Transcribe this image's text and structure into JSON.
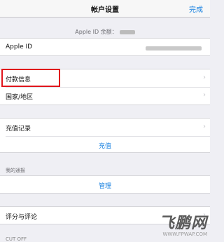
{
  "navbar": {
    "title": "帐户设置",
    "done": "完成"
  },
  "balance_label": "Apple ID 余额：",
  "apple_id": {
    "label": "Apple ID"
  },
  "payment": {
    "label": "付款信息"
  },
  "region": {
    "label": "国家/地区"
  },
  "recharge": {
    "label": "充值记录",
    "action": "充值"
  },
  "subscriptions": {
    "header": "我的通报",
    "action": "管理"
  },
  "ratings": {
    "label": "评分与评论"
  },
  "partial_section": "CUT OFF",
  "watermark": {
    "logo": "飞鹏网",
    "url": "WWW.FPWAP.COM"
  },
  "colors": {
    "accent": "#1a82e0",
    "highlight": "#e0151c",
    "background": "#efeff4"
  }
}
